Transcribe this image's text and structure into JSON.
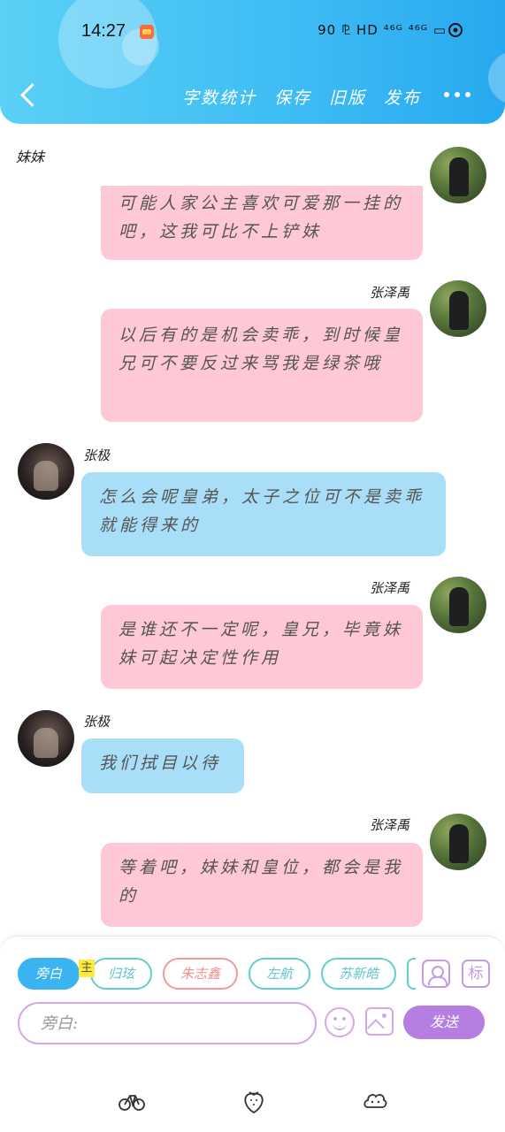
{
  "status_bar": {
    "time": "14:27",
    "indicators": "90 ⅊ HD ⁴⁶ᴳ ⁴⁶ᴳ ▭"
  },
  "header": {
    "actions": [
      "字数统计",
      "保存",
      "旧版",
      "发布"
    ],
    "back_icon": "chevron-left-icon",
    "more_icon": "ellipsis-icon",
    "color_start": "#5ad0f5",
    "color_end": "#27a9f0"
  },
  "chat": {
    "section_label": "妹妹",
    "messages": [
      {
        "side": "right",
        "sender": "",
        "text": "可能人家公主喜欢可爱那一挂的吧，这我可比不上铲妹",
        "color": "#ffc8d6"
      },
      {
        "side": "right",
        "sender": "张泽禹",
        "text": "以后有的是机会卖乖，到时候皇兄可不要反过来骂我是绿茶哦",
        "color": "#ffc8d6"
      },
      {
        "side": "left",
        "sender": "张极",
        "text": "怎么会呢皇弟，太子之位可不是卖乖就能得来的",
        "color": "#a8def8"
      },
      {
        "side": "right",
        "sender": "张泽禹",
        "text": "是谁还不一定呢，皇兄，毕竟妹妹可起决定性作用",
        "color": "#ffc8d6"
      },
      {
        "side": "left",
        "sender": "张极",
        "text": "我们拭目以待",
        "color": "#a8def8"
      },
      {
        "side": "right",
        "sender": "张泽禹",
        "text": "等着吧，妹妹和皇位，都会是我的",
        "color": "#ffc8d6"
      }
    ]
  },
  "input_panel": {
    "roles": [
      "旁白",
      "归玹",
      "朱志鑫",
      "左航",
      "苏新皓"
    ],
    "main_tag": "主",
    "tag_button": "标",
    "input_placeholder": "旁白:",
    "send_label": "发送",
    "send_color": "#b57ee0"
  },
  "bottom_nav": {
    "icons": [
      "bicycle-icon",
      "strawberry-icon",
      "cloud-flower-icon"
    ]
  }
}
